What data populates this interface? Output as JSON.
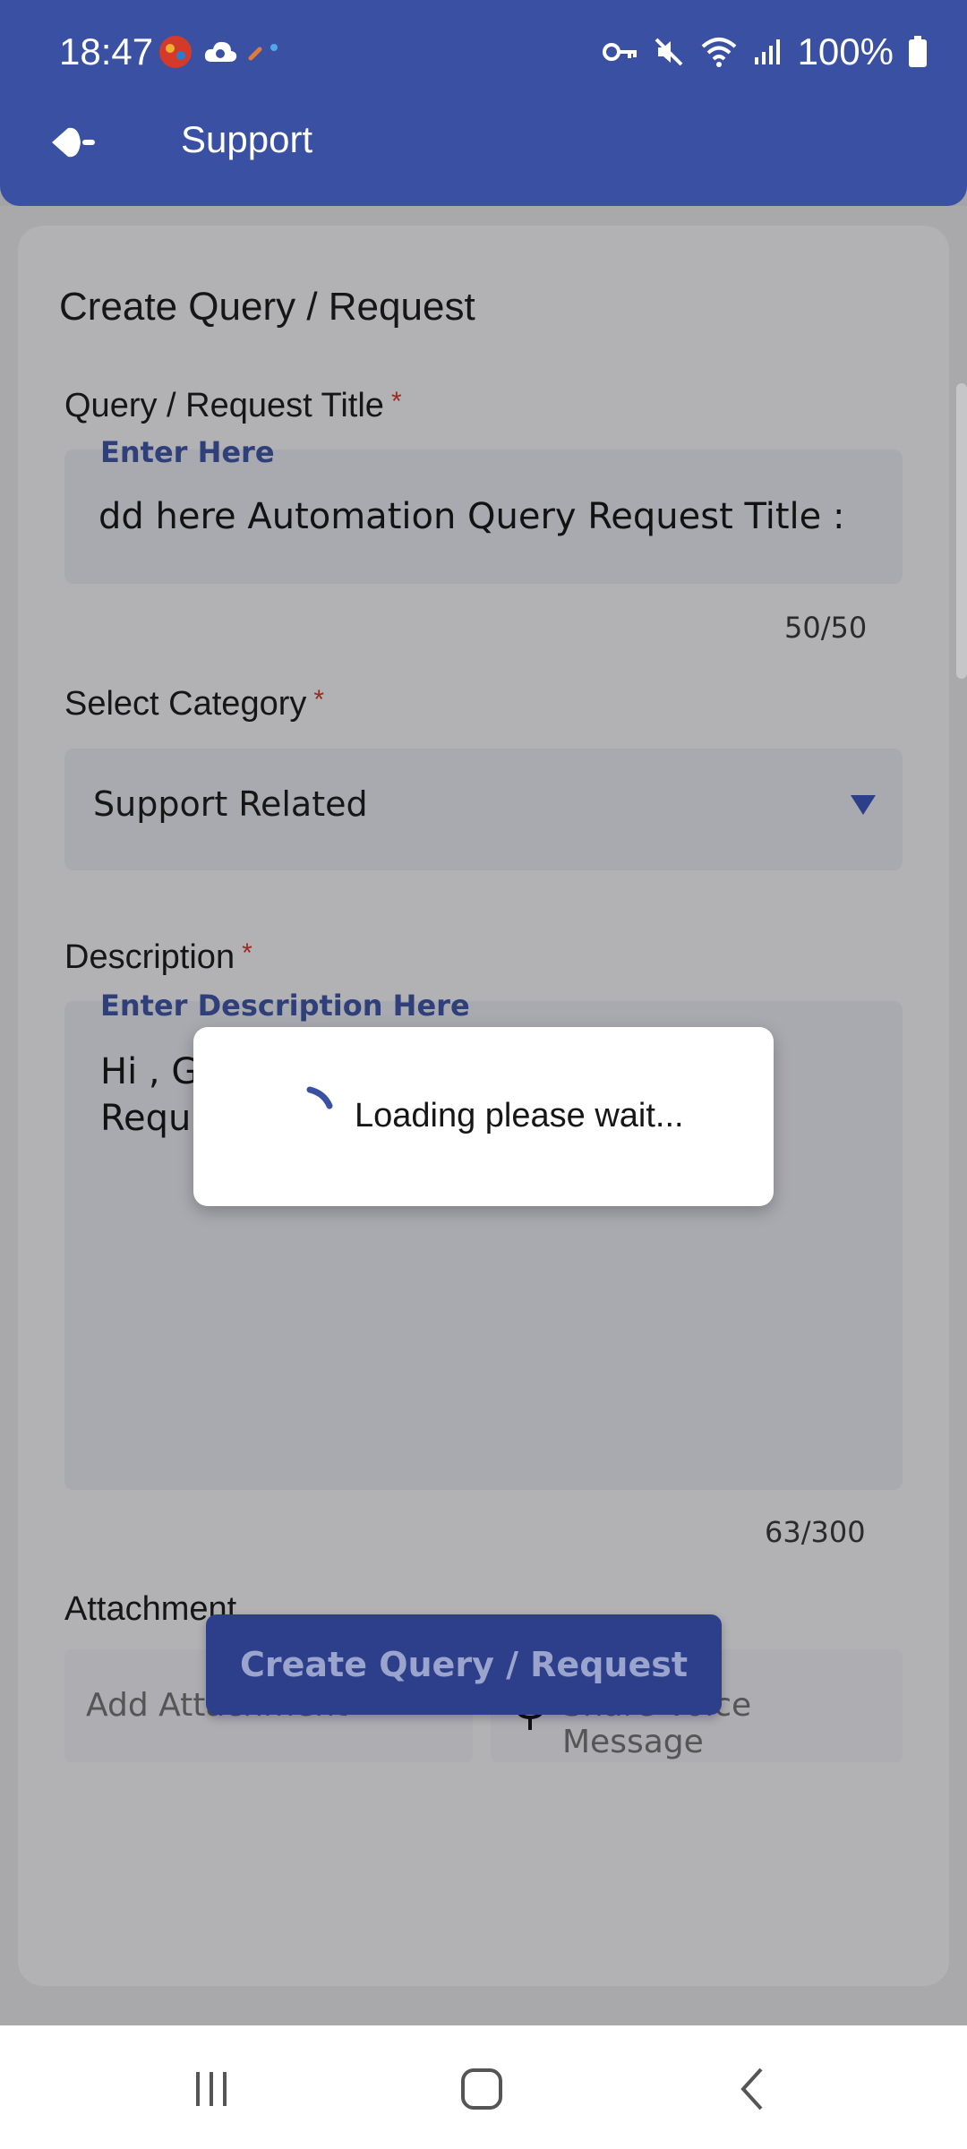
{
  "status_bar": {
    "time": "18:47",
    "battery": "100%"
  },
  "toolbar": {
    "title": "Support"
  },
  "form": {
    "title": "Create Query / Request",
    "query_title": {
      "label": "Query / Request Title",
      "required_mark": "*",
      "floating_label": "Enter Here",
      "value": "dd here Automation Query Request Title :",
      "counter": "50/50"
    },
    "category": {
      "label": "Select Category",
      "required_mark": "*",
      "selected": "Support Related"
    },
    "description": {
      "label": "Description",
      "required_mark": "*",
      "floating_label": "Enter Description Here",
      "value_line1": "Hi , G",
      "value_line2": "Requ",
      "counter": "63/300"
    },
    "attachment": {
      "label": "Attachment",
      "add_label": "Add Attachment",
      "voice_label": "Share Voice Message"
    },
    "submit_label": "Create Query / Request"
  },
  "loading_dialog": {
    "message": "Loading please wait..."
  },
  "colors": {
    "primary": "#3a51a3",
    "button": "#2d3f8b",
    "required": "#9c2a22"
  }
}
